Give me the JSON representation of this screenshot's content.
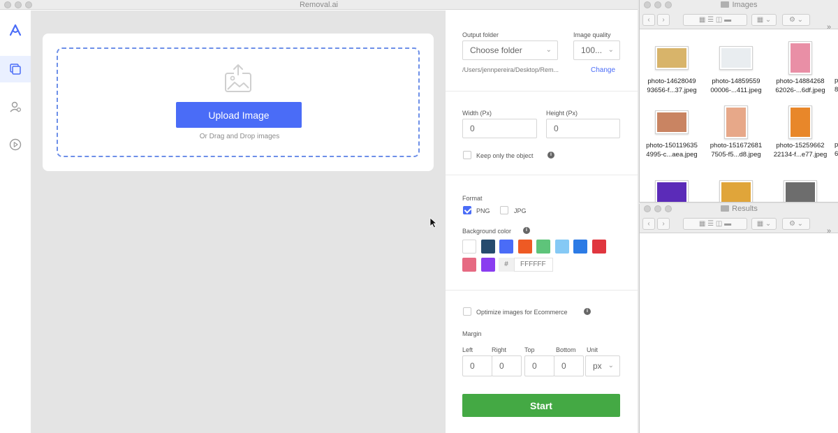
{
  "app": {
    "title": "Removal.ai",
    "upload_label": "Upload Image",
    "drag_text": "Or Drag and Drop images"
  },
  "settings": {
    "output_folder_label": "Output folder",
    "output_folder_value": "Choose folder",
    "image_quality_label": "Image quality",
    "image_quality_value": "100...",
    "path": "/Users/jennpereira/Desktop/Rem...",
    "change_label": "Change",
    "width_label": "Width (Px)",
    "width_value": "0",
    "height_label": "Height (Px)",
    "height_value": "0",
    "keep_object_label": "Keep only the object",
    "format_label": "Format",
    "png_label": "PNG",
    "png_checked": true,
    "jpg_label": "JPG",
    "jpg_checked": false,
    "bg_color_label": "Background color",
    "swatches": [
      "#ffffff",
      "#264b6e",
      "#4a6cf7",
      "#ee5a24",
      "#5ec47a",
      "#85c9f5",
      "#2c7be5",
      "#e0363f",
      "#e66a82",
      "#8a3df0"
    ],
    "hash_symbol": "#",
    "hex_value": "FFFFFF",
    "optimize_label": "Optimize images for Ecommerce",
    "margin_label": "Margin",
    "left_label": "Left",
    "right_label": "Right",
    "top_label": "Top",
    "bottom_label": "Bottom",
    "unit_label": "Unit",
    "left_value": "0",
    "right_value": "0",
    "top_value": "0",
    "bottom_value": "0",
    "unit_value": "px",
    "start_label": "Start"
  },
  "finder_images": {
    "title": "Images",
    "files": [
      {
        "line1": "photo-14628049",
        "line2": "93656-f...37.jpeg",
        "color": "#d8b46a"
      },
      {
        "line1": "photo-14859559",
        "line2": "00006-...411.jpeg",
        "color": "#e9edf0"
      },
      {
        "line1": "photo-14884268",
        "line2": "62026-...6df.jpeg",
        "color": "#e98fa6"
      },
      {
        "line1": "photo-150119635",
        "line2": "4995-c...aea.jpeg",
        "color": "#c98462"
      },
      {
        "line1": "photo-151672681",
        "line2": "7505-f5...d8.jpeg",
        "color": "#e7a889"
      },
      {
        "line1": "photo-15259662",
        "line2": "22134-f...e77.jpeg",
        "color": "#e8872a"
      },
      {
        "line1": "",
        "line2": "",
        "color": "#5b2bb8"
      },
      {
        "line1": "",
        "line2": "",
        "color": "#e0a53a"
      },
      {
        "line1": "",
        "line2": "",
        "color": "#6d6d6d"
      }
    ],
    "partial_col": [
      "p",
      "8",
      "p",
      "6"
    ]
  },
  "finder_results": {
    "title": "Results"
  },
  "colors": {
    "accent": "#4a6cf7",
    "start": "#44a944"
  }
}
